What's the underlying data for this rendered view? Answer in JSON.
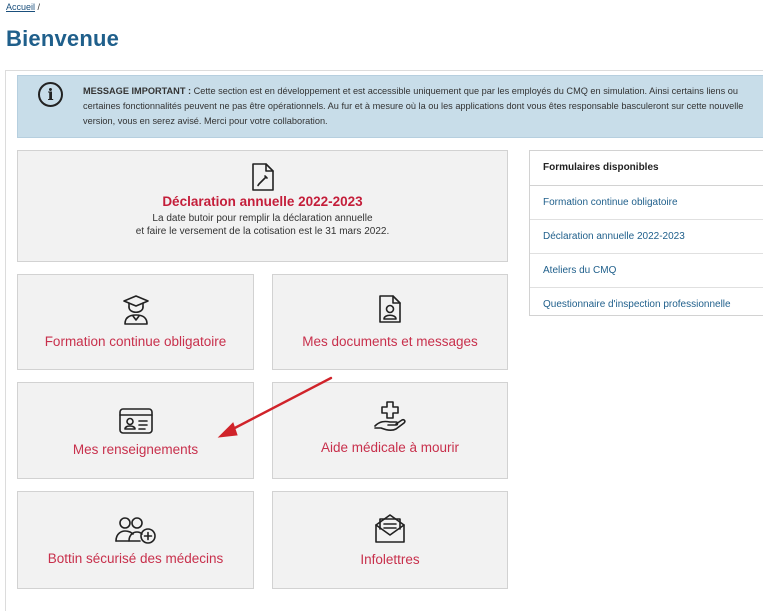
{
  "breadcrumb": {
    "home": "Accueil",
    "separator": " /"
  },
  "page": {
    "title": "Bienvenue"
  },
  "notice": {
    "icon": "info-icon",
    "bold": "MESSAGE IMPORTANT :",
    "text": " Cette section est en développement et est accessible uniquement que par les employés du CMQ en simulation. Ainsi certains liens ou certaines fonctionnalités peuvent ne pas être opérationnels. Au fur et à mesure où la ou les applications dont vous êtes responsable basculeront sur cette nouvelle version, vous en serez avisé. Merci pour votre collaboration."
  },
  "declaration": {
    "icon": "document-edit-icon",
    "title": "Déclaration annuelle 2022-2023",
    "line1": "La date butoir pour remplir la déclaration annuelle",
    "line2": "et faire le versement de la cotisation est le 31 mars 2022."
  },
  "cards": {
    "formation": {
      "label": "Formation continue obligatoire",
      "icon": "graduate-icon"
    },
    "documents": {
      "label": "Mes documents et messages",
      "icon": "user-document-icon"
    },
    "renseignements": {
      "label": "Mes renseignements",
      "icon": "id-card-icon"
    },
    "aide": {
      "label": "Aide médicale à mourir",
      "icon": "medical-hand-icon"
    },
    "bottin": {
      "label": "Bottin sécurisé des médecins",
      "icon": "users-add-icon"
    },
    "infolettres": {
      "label": "Infolettres",
      "icon": "newsletter-envelope-icon"
    }
  },
  "sidebar": {
    "title": "Formulaires disponibles",
    "items": [
      {
        "label": "Formation continue obligatoire"
      },
      {
        "label": "Déclaration annuelle 2022-2023"
      },
      {
        "label": "Ateliers du CMQ"
      },
      {
        "label": "Questionnaire d'inspection professionnelle"
      }
    ]
  },
  "colors": {
    "title": "#1f5f8b",
    "accent": "#c8304c",
    "notice_bg": "#c8dde9",
    "card_bg": "#f2f2f2",
    "arrow": "#d0232a"
  }
}
